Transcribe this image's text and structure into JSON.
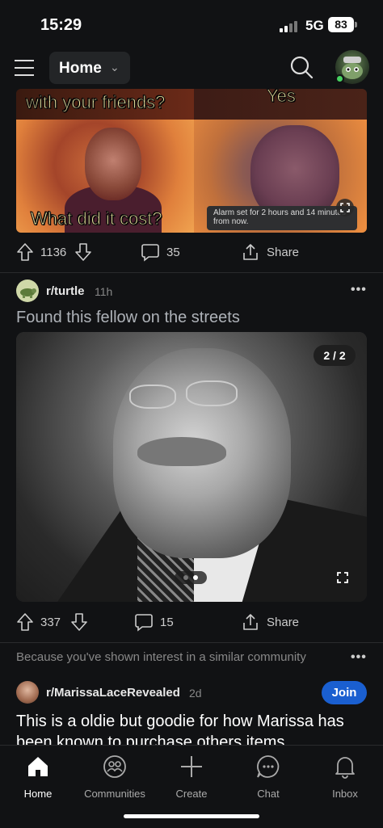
{
  "status_bar": {
    "time": "15:29",
    "network": "5G",
    "battery": "83"
  },
  "nav": {
    "feed_label": "Home"
  },
  "post1": {
    "meme_text_top": "with your friends?",
    "meme_text_yes": "Yes",
    "meme_text_bottom": "What did it cost?",
    "toast": "Alarm set for 2 hours and 14 minutes from now.",
    "votes": "1136",
    "comments": "35",
    "share_label": "Share"
  },
  "post2": {
    "subreddit": "r/turtle",
    "age": "11h",
    "title": "Found this fellow on the streets",
    "image_counter": "2 / 2",
    "votes": "337",
    "comments": "15",
    "share_label": "Share"
  },
  "recommendation": {
    "reason": "Because you've shown interest in a similar community"
  },
  "post3": {
    "subreddit": "r/MarissaLaceRevealed",
    "age": "2d",
    "join_label": "Join",
    "title": "This is a oldie but goodie for how Marissa has been known to purchase others items"
  },
  "tabbar": {
    "items": [
      {
        "label": "Home",
        "icon": "home-icon"
      },
      {
        "label": "Communities",
        "icon": "communities-icon"
      },
      {
        "label": "Create",
        "icon": "plus-icon"
      },
      {
        "label": "Chat",
        "icon": "chat-icon"
      },
      {
        "label": "Inbox",
        "icon": "bell-icon"
      }
    ]
  },
  "colors": {
    "background": "#111214",
    "join_button": "#1a5fd0",
    "online": "#46d160"
  }
}
